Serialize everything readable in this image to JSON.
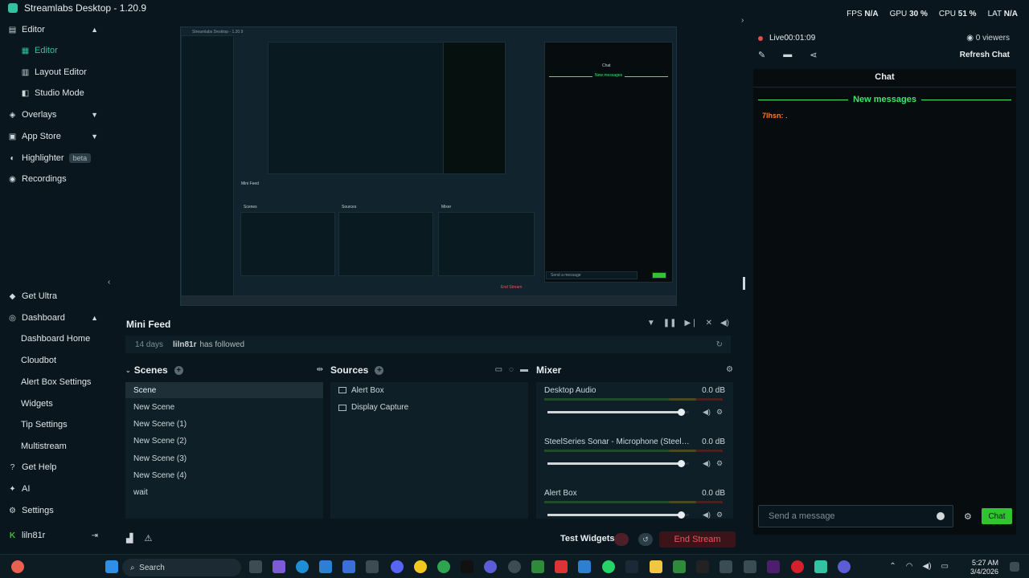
{
  "app": {
    "title": "Streamlabs Desktop - 1.20.9"
  },
  "window_controls": [
    "—",
    "▢",
    "✕"
  ],
  "stats": {
    "fps_label": "FPS",
    "fps": "N/A",
    "gpu_label": "GPU",
    "gpu": "30 %",
    "cpu_label": "CPU",
    "cpu": "51 %",
    "lat_label": "LAT",
    "lat": "N/A"
  },
  "sidebar": {
    "editor": "Editor",
    "editor_sub": "Editor",
    "layout_editor": "Layout Editor",
    "studio_mode": "Studio Mode",
    "overlays": "Overlays",
    "app_store": "App Store",
    "highlighter": "Highlighter",
    "beta": "beta",
    "recordings": "Recordings",
    "get_ultra": "Get Ultra",
    "dashboard": "Dashboard",
    "dashboard_home": "Dashboard Home",
    "cloudbot": "Cloudbot",
    "alert_box_settings": "Alert Box Settings",
    "widgets": "Widgets",
    "tip_settings": "Tip Settings",
    "multistream": "Multistream",
    "get_help": "Get Help",
    "ai": "AI",
    "settings": "Settings",
    "user": "liln81r"
  },
  "minifeed": {
    "title": "Mini Feed",
    "days": "14 days",
    "user": "liln81r",
    "action": "has followed"
  },
  "scenes": {
    "title": "Scenes",
    "items": [
      "Scene",
      "New Scene",
      "New Scene (1)",
      "New Scene (2)",
      "New Scene (3)",
      "New Scene (4)",
      "wait"
    ]
  },
  "sources": {
    "title": "Sources",
    "items": [
      "Alert Box",
      "Display Capture"
    ]
  },
  "mixer": {
    "title": "Mixer",
    "channels": [
      {
        "name": "Desktop Audio",
        "db": "0.0 dB",
        "level": 0.95
      },
      {
        "name": "SteelSeries Sonar - Microphone (SteelSeri...",
        "db": "0.0 dB",
        "level": 0.95
      },
      {
        "name": "Alert Box",
        "db": "0.0 dB",
        "level": 0.95
      }
    ]
  },
  "footer": {
    "test_widgets": "Test Widgets",
    "end_stream": "End Stream"
  },
  "chat": {
    "live": "Live",
    "live_time": "00:01:09",
    "viewers": "0 viewers",
    "refresh": "Refresh Chat",
    "title": "Chat",
    "new_messages": "New messages",
    "message_user": "7lhsn:",
    "message_text": ".",
    "input_placeholder": "Send a message",
    "send": "Chat"
  },
  "taskbar": {
    "search": "Search",
    "time": "5:27 AM",
    "date": "3/4/2026"
  },
  "preview": {
    "app_title": "Streamlabs Desktop - 1.20.9",
    "chat_title": "Chat",
    "new_messages": "New messages",
    "send_placeholder": "Send a message",
    "mini_feed": "Mini Feed",
    "scenes": "Scenes",
    "sources": "Sources",
    "mixer": "Mixer",
    "end_stream": "End Stream"
  },
  "colors": {
    "accent": "#31c3a2",
    "live": "#e34c4c",
    "new_messages": "#40e56d",
    "end_stream": "#f0535b",
    "chat_button": "#31c330"
  }
}
